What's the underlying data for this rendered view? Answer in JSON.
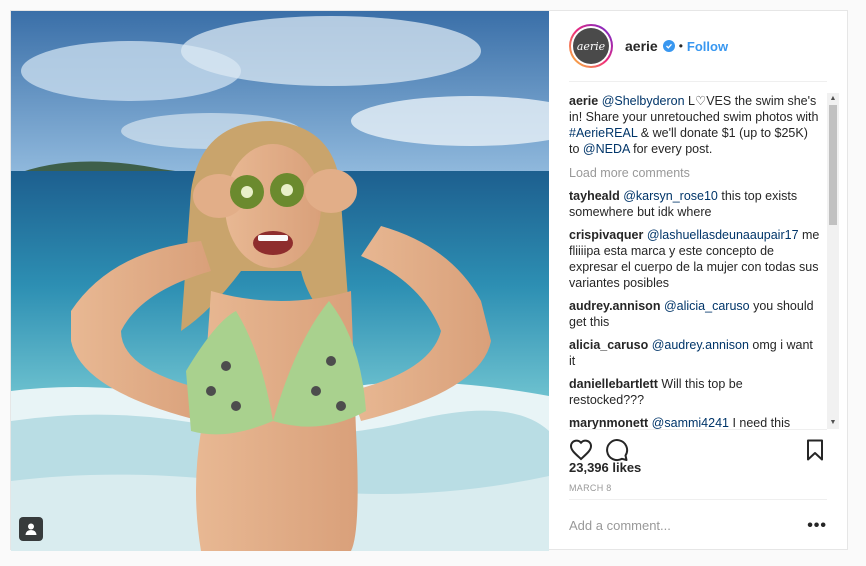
{
  "post": {
    "username": "aerie",
    "avatar_text": "aerie",
    "follow_label": "Follow",
    "separator": "•",
    "caption": {
      "username": "aerie",
      "mention1": "@Shelbyderon",
      "text1": " L♡VES the swim she's in! Share your unretouched swim photos with ",
      "hashtag": "#AerieREAL",
      "text2": " & we'll donate $1 (up to $25K) to ",
      "mention2": "@NEDA",
      "text3": " for every post."
    },
    "load_more": "Load more comments",
    "comments": [
      {
        "user": "tayheald",
        "mention": "@karsyn_rose10",
        "text": " this top exists somewhere but idk where"
      },
      {
        "user": "crispivaquer",
        "mention": "@lashuellasdeunaaupair17",
        "text": " me fliiiipa esta marca y este concepto de expresar el cuerpo de la mujer con todas sus variantes posibles"
      },
      {
        "user": "audrey.annison",
        "mention": "@alicia_caruso",
        "text": " you should get this"
      },
      {
        "user": "alicia_caruso",
        "mention": "@audrey.annison",
        "text": " omg i want it"
      },
      {
        "user": "daniellebartlett",
        "mention": "",
        "text": "Will this top be restocked???"
      },
      {
        "user": "marynmonett",
        "mention": "@sammi4241",
        "text": " I need this"
      }
    ],
    "likes": "23,396 likes",
    "date": "MARCH 8",
    "add_comment_placeholder": "Add a comment...",
    "more_label": "•••"
  },
  "icons": {
    "like": "heart-icon",
    "comment": "comment-bubble-icon",
    "save": "bookmark-icon",
    "verified": "verified-badge-icon",
    "tag": "person-tag-icon"
  },
  "colors": {
    "link": "#3897f0",
    "mention": "#003569",
    "muted": "#999999"
  }
}
